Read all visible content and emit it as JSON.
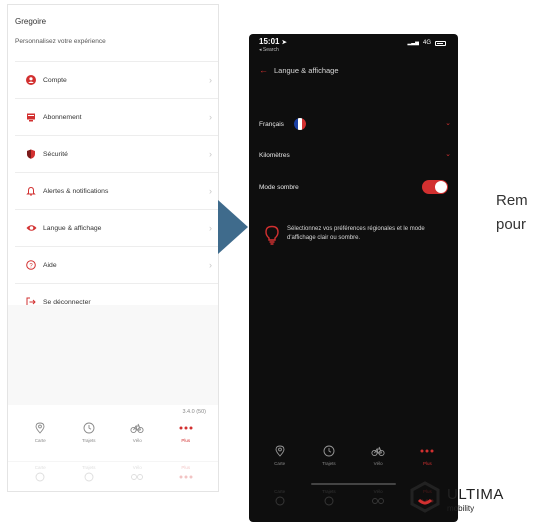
{
  "light_app": {
    "user_name": "Gregoire",
    "subtitle": "Personnalisez votre expérience",
    "menu": [
      {
        "label": "Compte",
        "icon": "user-icon"
      },
      {
        "label": "Abonnement",
        "icon": "subscription-icon"
      },
      {
        "label": "Sécurité",
        "icon": "shield-icon"
      },
      {
        "label": "Alertes & notifications",
        "icon": "bell-icon"
      },
      {
        "label": "Langue & affichage",
        "icon": "eye-icon"
      },
      {
        "label": "Aide",
        "icon": "help-icon"
      },
      {
        "label": "Se déconnecter",
        "icon": "logout-icon"
      }
    ],
    "version": "3.4.0 (50)",
    "tabs": [
      {
        "label": "Carte",
        "icon": "map-pin-icon",
        "active": false
      },
      {
        "label": "Trajets",
        "icon": "clock-icon",
        "active": false
      },
      {
        "label": "Vélo",
        "icon": "bike-icon",
        "active": false
      },
      {
        "label": "Plus",
        "icon": "more-icon",
        "active": true
      }
    ]
  },
  "dark_app": {
    "status_time": "15:01",
    "status_back": "◂ Search",
    "network": "4G",
    "header_title": "Langue & affichage",
    "language_label": "Français",
    "distance_label": "Kilomètres",
    "dark_mode_label": "Mode sombre",
    "dark_mode_enabled": true,
    "tip_text": "Sélectionnez vos préférences régionales et le mode d'affichage clair ou sombre.",
    "tabs": [
      {
        "label": "Carte",
        "icon": "map-pin-icon",
        "active": false
      },
      {
        "label": "Trajets",
        "icon": "clock-icon",
        "active": false
      },
      {
        "label": "Vélo",
        "icon": "bike-icon",
        "active": false
      },
      {
        "label": "Plus",
        "icon": "more-icon",
        "active": true
      }
    ]
  },
  "side_text": [
    "Rem",
    "pour"
  ],
  "logo": {
    "name": "ULTIMA",
    "sub": "mobility"
  },
  "colors": {
    "accent": "#d23030",
    "arrow": "#3f6b8c",
    "dark_bg": "#0e0e0e"
  }
}
